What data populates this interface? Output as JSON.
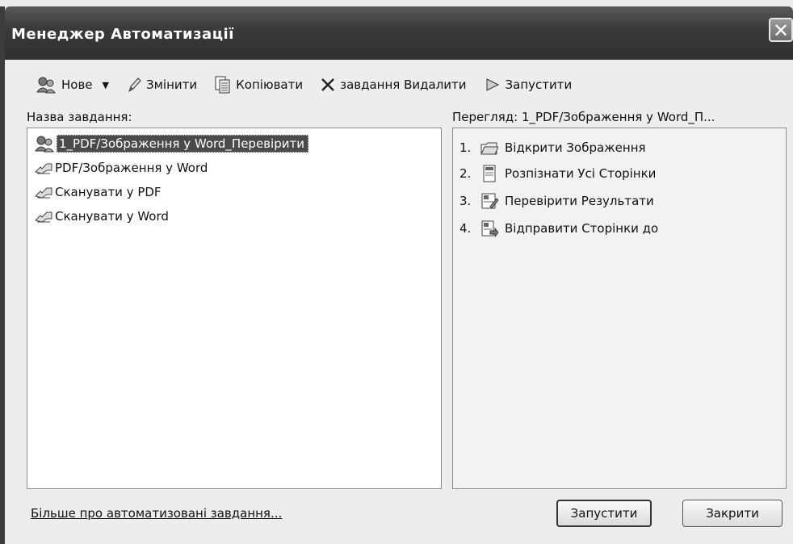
{
  "window": {
    "title": "Менеджер Автоматизації",
    "close_glyph": "✕"
  },
  "toolbar": {
    "new_label": "Нове",
    "edit_label": "Змінити",
    "copy_label": "Копіювати",
    "delete_label": "завдання Видалити",
    "run_label": "Запустити"
  },
  "tasks": {
    "header": "Назва завдання:",
    "items": [
      {
        "label": "1_PDF/Зображення у Word_Перевірити",
        "selected": true,
        "icon": "custom-task-icon"
      },
      {
        "label": "PDF/Зображення у Word",
        "selected": false,
        "icon": "builtin-task-icon"
      },
      {
        "label": "Сканувати у PDF",
        "selected": false,
        "icon": "builtin-task-icon"
      },
      {
        "label": "Сканувати у Word",
        "selected": false,
        "icon": "builtin-task-icon"
      }
    ]
  },
  "preview": {
    "header": "Перегляд: 1_PDF/Зображення у Word_П...",
    "steps": [
      {
        "num": "1.",
        "label": "Відкрити Зображення",
        "icon": "open-image-icon"
      },
      {
        "num": "2.",
        "label": "Розпізнати Усі Сторінки",
        "icon": "recognize-pages-icon"
      },
      {
        "num": "3.",
        "label": "Перевірити Результати",
        "icon": "verify-results-icon"
      },
      {
        "num": "4.",
        "label": "Відправити Сторінки до",
        "icon": "send-pages-icon"
      }
    ]
  },
  "footer": {
    "link": "Більше про автоматизовані завдання...",
    "run_button": "Запустити",
    "close_button": "Закрити"
  }
}
